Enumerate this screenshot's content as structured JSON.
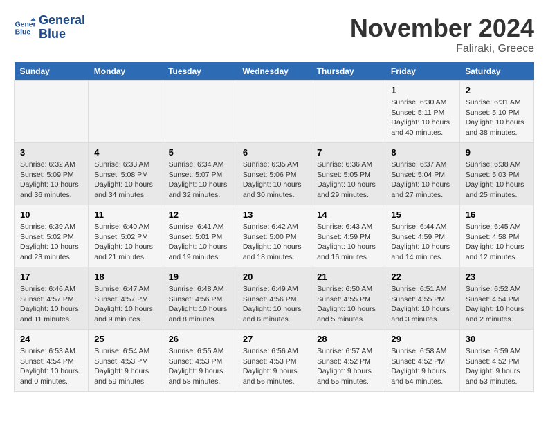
{
  "logo": {
    "line1": "General",
    "line2": "Blue"
  },
  "title": "November 2024",
  "location": "Faliraki, Greece",
  "days_of_week": [
    "Sunday",
    "Monday",
    "Tuesday",
    "Wednesday",
    "Thursday",
    "Friday",
    "Saturday"
  ],
  "weeks": [
    [
      {
        "day": "",
        "info": ""
      },
      {
        "day": "",
        "info": ""
      },
      {
        "day": "",
        "info": ""
      },
      {
        "day": "",
        "info": ""
      },
      {
        "day": "",
        "info": ""
      },
      {
        "day": "1",
        "info": "Sunrise: 6:30 AM\nSunset: 5:11 PM\nDaylight: 10 hours\nand 40 minutes."
      },
      {
        "day": "2",
        "info": "Sunrise: 6:31 AM\nSunset: 5:10 PM\nDaylight: 10 hours\nand 38 minutes."
      }
    ],
    [
      {
        "day": "3",
        "info": "Sunrise: 6:32 AM\nSunset: 5:09 PM\nDaylight: 10 hours\nand 36 minutes."
      },
      {
        "day": "4",
        "info": "Sunrise: 6:33 AM\nSunset: 5:08 PM\nDaylight: 10 hours\nand 34 minutes."
      },
      {
        "day": "5",
        "info": "Sunrise: 6:34 AM\nSunset: 5:07 PM\nDaylight: 10 hours\nand 32 minutes."
      },
      {
        "day": "6",
        "info": "Sunrise: 6:35 AM\nSunset: 5:06 PM\nDaylight: 10 hours\nand 30 minutes."
      },
      {
        "day": "7",
        "info": "Sunrise: 6:36 AM\nSunset: 5:05 PM\nDaylight: 10 hours\nand 29 minutes."
      },
      {
        "day": "8",
        "info": "Sunrise: 6:37 AM\nSunset: 5:04 PM\nDaylight: 10 hours\nand 27 minutes."
      },
      {
        "day": "9",
        "info": "Sunrise: 6:38 AM\nSunset: 5:03 PM\nDaylight: 10 hours\nand 25 minutes."
      }
    ],
    [
      {
        "day": "10",
        "info": "Sunrise: 6:39 AM\nSunset: 5:02 PM\nDaylight: 10 hours\nand 23 minutes."
      },
      {
        "day": "11",
        "info": "Sunrise: 6:40 AM\nSunset: 5:02 PM\nDaylight: 10 hours\nand 21 minutes."
      },
      {
        "day": "12",
        "info": "Sunrise: 6:41 AM\nSunset: 5:01 PM\nDaylight: 10 hours\nand 19 minutes."
      },
      {
        "day": "13",
        "info": "Sunrise: 6:42 AM\nSunset: 5:00 PM\nDaylight: 10 hours\nand 18 minutes."
      },
      {
        "day": "14",
        "info": "Sunrise: 6:43 AM\nSunset: 4:59 PM\nDaylight: 10 hours\nand 16 minutes."
      },
      {
        "day": "15",
        "info": "Sunrise: 6:44 AM\nSunset: 4:59 PM\nDaylight: 10 hours\nand 14 minutes."
      },
      {
        "day": "16",
        "info": "Sunrise: 6:45 AM\nSunset: 4:58 PM\nDaylight: 10 hours\nand 12 minutes."
      }
    ],
    [
      {
        "day": "17",
        "info": "Sunrise: 6:46 AM\nSunset: 4:57 PM\nDaylight: 10 hours\nand 11 minutes."
      },
      {
        "day": "18",
        "info": "Sunrise: 6:47 AM\nSunset: 4:57 PM\nDaylight: 10 hours\nand 9 minutes."
      },
      {
        "day": "19",
        "info": "Sunrise: 6:48 AM\nSunset: 4:56 PM\nDaylight: 10 hours\nand 8 minutes."
      },
      {
        "day": "20",
        "info": "Sunrise: 6:49 AM\nSunset: 4:56 PM\nDaylight: 10 hours\nand 6 minutes."
      },
      {
        "day": "21",
        "info": "Sunrise: 6:50 AM\nSunset: 4:55 PM\nDaylight: 10 hours\nand 5 minutes."
      },
      {
        "day": "22",
        "info": "Sunrise: 6:51 AM\nSunset: 4:55 PM\nDaylight: 10 hours\nand 3 minutes."
      },
      {
        "day": "23",
        "info": "Sunrise: 6:52 AM\nSunset: 4:54 PM\nDaylight: 10 hours\nand 2 minutes."
      }
    ],
    [
      {
        "day": "24",
        "info": "Sunrise: 6:53 AM\nSunset: 4:54 PM\nDaylight: 10 hours\nand 0 minutes."
      },
      {
        "day": "25",
        "info": "Sunrise: 6:54 AM\nSunset: 4:53 PM\nDaylight: 9 hours\nand 59 minutes."
      },
      {
        "day": "26",
        "info": "Sunrise: 6:55 AM\nSunset: 4:53 PM\nDaylight: 9 hours\nand 58 minutes."
      },
      {
        "day": "27",
        "info": "Sunrise: 6:56 AM\nSunset: 4:53 PM\nDaylight: 9 hours\nand 56 minutes."
      },
      {
        "day": "28",
        "info": "Sunrise: 6:57 AM\nSunset: 4:52 PM\nDaylight: 9 hours\nand 55 minutes."
      },
      {
        "day": "29",
        "info": "Sunrise: 6:58 AM\nSunset: 4:52 PM\nDaylight: 9 hours\nand 54 minutes."
      },
      {
        "day": "30",
        "info": "Sunrise: 6:59 AM\nSunset: 4:52 PM\nDaylight: 9 hours\nand 53 minutes."
      }
    ]
  ]
}
